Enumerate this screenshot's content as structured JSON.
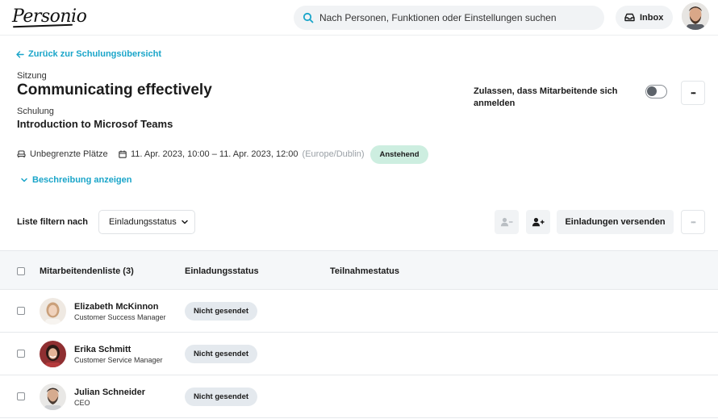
{
  "app": {
    "logo": "Personio"
  },
  "search": {
    "placeholder": "Nach Personen, Funktionen oder Einstellungen suchen"
  },
  "inbox": {
    "label": "Inbox"
  },
  "header": {
    "back_label": "Zurück zur Schulungsübersicht",
    "session_label": "Sitzung",
    "session_title": "Communicating effectively",
    "training_label": "Schulung",
    "training_title": "Introduction to Microsof Teams",
    "allow_signup_label": "Zulassen, dass Mitarbeitende sich anmelden",
    "more_label": "•••"
  },
  "meta": {
    "seats": "Unbegrenzte Plätze",
    "datetime": "11. Apr. 2023, 10:00 – 11. Apr. 2023, 12:00",
    "timezone": "(Europe/Dublin)",
    "status": "Anstehend",
    "show_description": "Beschreibung anzeigen"
  },
  "filter": {
    "label": "Liste filtern nach",
    "select_value": "Einladungsstatus",
    "send_invites": "Einladungen versenden",
    "more_label": "•••"
  },
  "table": {
    "headers": {
      "employees": "Mitarbeitendenliste (3)",
      "invite_status": "Einladungsstatus",
      "attendance_status": "Teilnahmestatus"
    },
    "rows": [
      {
        "name": "Elizabeth McKinnon",
        "role": "Customer Success Manager",
        "status": "Nicht gesendet"
      },
      {
        "name": "Erika Schmitt",
        "role": "Customer Service Manager",
        "status": "Nicht gesendet"
      },
      {
        "name": "Julian Schneider",
        "role": "CEO",
        "status": "Nicht gesendet"
      }
    ]
  },
  "colors": {
    "accent": "#1aa5c9",
    "status_upcoming": "#cdeee0",
    "status_not_sent": "#e4e9ee"
  }
}
